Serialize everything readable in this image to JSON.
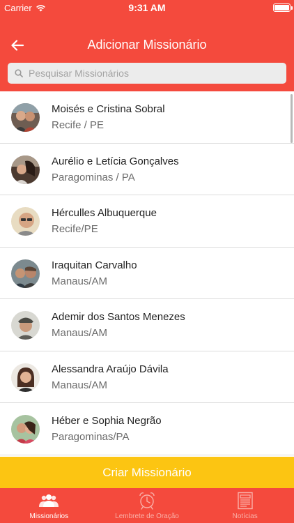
{
  "status_bar": {
    "carrier": "Carrier",
    "time": "9:31 AM"
  },
  "navbar": {
    "title": "Adicionar Missionário",
    "back_icon": "arrow-left-icon"
  },
  "search": {
    "placeholder": "Pesquisar Missionários",
    "value": ""
  },
  "missionaries": [
    {
      "name": "Moisés e Cristina Sobral",
      "location": "Recife / PE"
    },
    {
      "name": "Aurélio e Letícia Gonçalves",
      "location": "Paragominas / PA"
    },
    {
      "name": "Hérculles Albuquerque",
      "location": "Recife/PE"
    },
    {
      "name": "Iraquitan Carvalho",
      "location": "Manaus/AM"
    },
    {
      "name": "Ademir dos Santos Menezes",
      "location": "Manaus/AM"
    },
    {
      "name": "Alessandra Araújo Dávila",
      "location": "Manaus/AM"
    },
    {
      "name": "Héber e Sophia Negrão",
      "location": "Paragominas/PA"
    }
  ],
  "create_button": {
    "label": "Criar Missionário"
  },
  "tabs": [
    {
      "label": "Missionários",
      "icon": "people-icon",
      "active": true
    },
    {
      "label": "Lembrete de Oração",
      "icon": "alarm-clock-icon",
      "active": false
    },
    {
      "label": "Notícias",
      "icon": "newspaper-icon",
      "active": false
    }
  ],
  "colors": {
    "primary": "#f44a3d",
    "accent": "#fcc512",
    "divider": "#dcdcdc"
  }
}
